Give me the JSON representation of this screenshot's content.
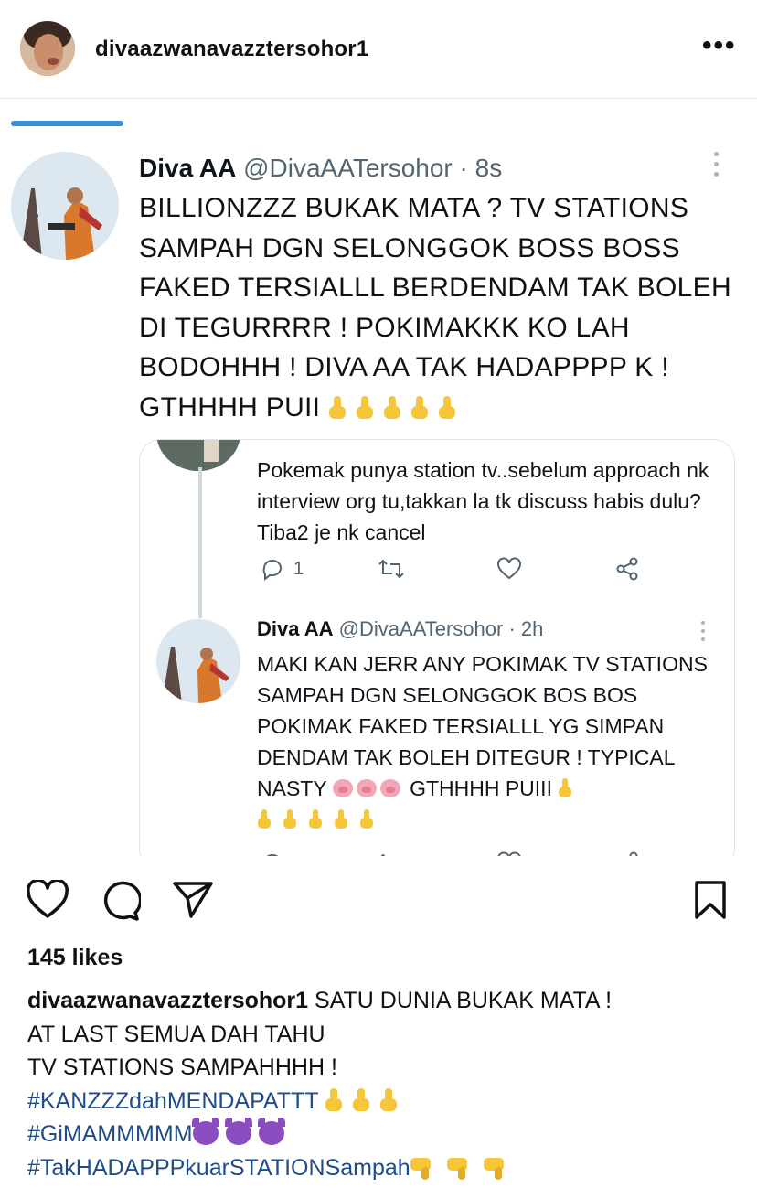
{
  "header": {
    "username": "divaazwanavazztersohor1",
    "more_label": "•••"
  },
  "tweet": {
    "name": "Diva AA",
    "handle": "@DivaAATersohor",
    "separator": "·",
    "time": "8s",
    "text": "BILLIONZZZ BUKAK MATA ? TV STATIONS SAMPAH DGN SELONGGOK BOSS BOSS FAKED TERSIALLL BERDENDAM TAK BOLEH DI TEGURRRR ! POKIMAKKK KO LAH BODOHHH ! DIVA AA TAK HADAPPPP K ! GTHHHH PUII"
  },
  "quoted": {
    "reply1_text": "Pokemak punya station tv..sebelum approach nk interview org tu,takkan la tk discuss habis dulu? Tiba2 je nk cancel",
    "reply1_reply_count": "1",
    "reply2_name": "Diva AA",
    "reply2_handle": "@DivaAATersohor",
    "reply2_separator": "·",
    "reply2_time": "2h",
    "reply2_text_1": "MAKI KAN JERR ANY POKIMAK TV STATIONS SAMPAH DGN SELONGGOK BOS BOS POKIMAK FAKED TERSIALLL YG SIMPAN DENDAM TAK BOLEH DITEGUR ! TYPICAL NASTY",
    "reply2_text_2": "GTHHHH PUIII"
  },
  "likes": "145 likes",
  "caption": {
    "user": "divaazwanavazztersohor1",
    "line1": "SATU DUNIA BUKAK MATA !",
    "line2": "AT LAST SEMUA DAH TAHU",
    "line3": "TV STATIONS SAMPAHHHH !",
    "tag1": "#KANZZZdahMENDAPATTT",
    "tag2": "#GiMAMMMMM",
    "tag3": "#TakHADAPPPkuarSTATIONSampah"
  },
  "colors": {
    "accent": "#3a8fd6",
    "hashtag": "#1e4d8a",
    "muted": "#536471"
  }
}
